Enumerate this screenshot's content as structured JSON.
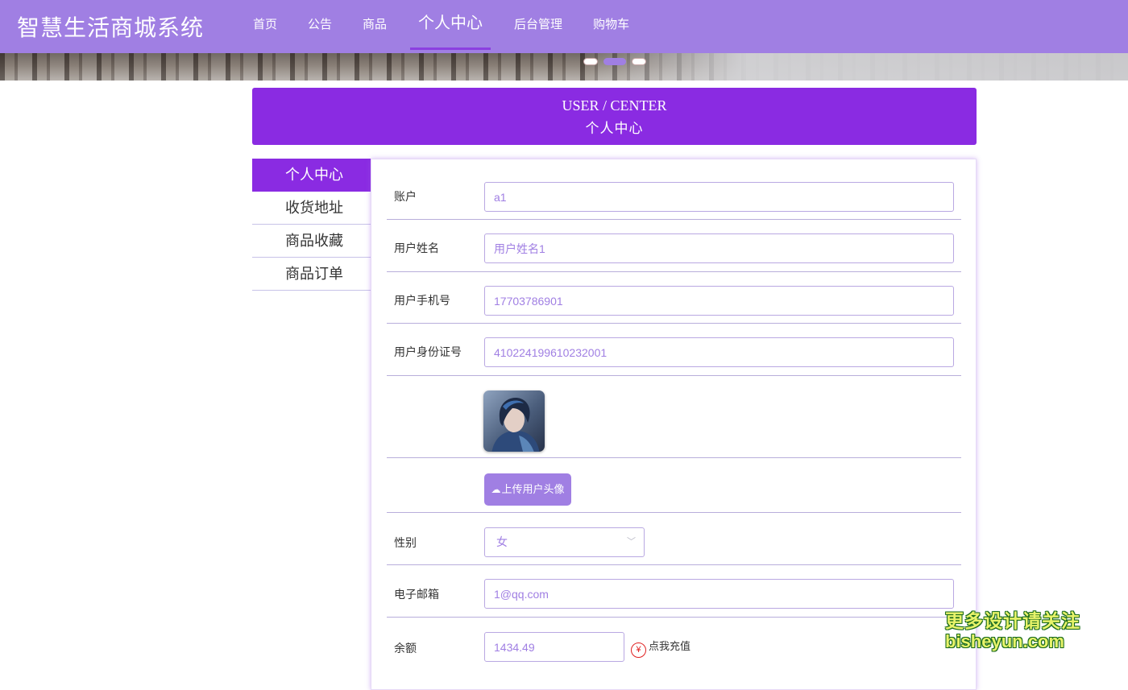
{
  "header": {
    "site_title": "智慧生活商城系统",
    "nav": [
      "首页",
      "公告",
      "商品",
      "个人中心",
      "后台管理",
      "购物车"
    ],
    "active_index": 3
  },
  "banner": {
    "active_dot": 1,
    "dot_count": 3
  },
  "page_title": {
    "en": "USER / CENTER",
    "cn": "个人中心"
  },
  "side_menu": {
    "items": [
      "个人中心",
      "收货地址",
      "商品收藏",
      "商品订单"
    ],
    "active_index": 0
  },
  "form": {
    "account": {
      "label": "账户",
      "value": "a1"
    },
    "username": {
      "label": "用户姓名",
      "value": "用户姓名1"
    },
    "phone": {
      "label": "用户手机号",
      "value": "17703786901"
    },
    "idcard": {
      "label": "用户身份证号",
      "value": "410224199610232001"
    },
    "upload_label": "上传用户头像",
    "gender": {
      "label": "性别",
      "value": "女"
    },
    "email": {
      "label": "电子邮箱",
      "value": "1@qq.com"
    },
    "balance": {
      "label": "余额",
      "value": "1434.49",
      "recharge_label": "点我充值",
      "currency_symbol": "¥"
    }
  },
  "watermark": {
    "line1": "更多设计请关注",
    "line2": "bisheyun.com"
  },
  "colors": {
    "header_bg": "#a07fe3",
    "accent_purple": "#8a2be2",
    "input_text": "#a07fe3",
    "recharge_icon": "#e02020"
  }
}
